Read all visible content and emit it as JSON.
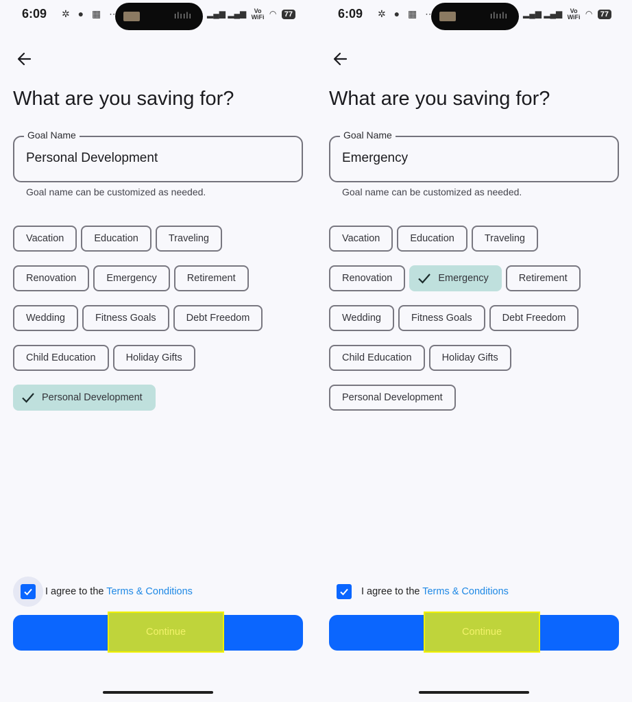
{
  "screens": [
    {
      "id": "left",
      "status": {
        "time": "6:09",
        "battery": "77",
        "wifi_label_top": "Vo",
        "wifi_label_bottom": "WiFi"
      },
      "title": "What are you saving for?",
      "goal_field": {
        "label": "Goal Name",
        "value": "Personal Development"
      },
      "helper": "Goal name can be customized as needed.",
      "chip_rows": [
        [
          {
            "label": "Vacation",
            "selected": false
          },
          {
            "label": "Education",
            "selected": false
          },
          {
            "label": "Traveling",
            "selected": false
          }
        ],
        [
          {
            "label": "Renovation",
            "selected": false
          },
          {
            "label": "Emergency",
            "selected": false
          },
          {
            "label": "Retirement",
            "selected": false
          }
        ],
        [
          {
            "label": "Wedding",
            "selected": false
          },
          {
            "label": "Fitness Goals",
            "selected": false
          },
          {
            "label": "Debt Freedom",
            "selected": false
          }
        ],
        [
          {
            "label": "Child Education",
            "selected": false
          },
          {
            "label": "Holiday Gifts",
            "selected": false
          }
        ],
        [
          {
            "label": "Personal Development",
            "selected": true
          }
        ]
      ],
      "agree": {
        "prefix": "I agree to the ",
        "link": "Terms & Conditions",
        "checked": true
      },
      "continue_label": "Continue"
    },
    {
      "id": "right",
      "status": {
        "time": "6:09",
        "battery": "77",
        "wifi_label_top": "Vo",
        "wifi_label_bottom": "WiFi"
      },
      "title": "What are you saving for?",
      "goal_field": {
        "label": "Goal Name",
        "value": "Emergency"
      },
      "helper": "Goal name can be customized as needed.",
      "chip_rows": [
        [
          {
            "label": "Vacation",
            "selected": false
          },
          {
            "label": "Education",
            "selected": false
          },
          {
            "label": "Traveling",
            "selected": false
          }
        ],
        [
          {
            "label": "Renovation",
            "selected": false
          },
          {
            "label": "Emergency",
            "selected": true
          },
          {
            "label": "Retirement",
            "selected": false
          }
        ],
        [
          {
            "label": "Wedding",
            "selected": false
          },
          {
            "label": "Fitness Goals",
            "selected": false
          },
          {
            "label": "Debt Freedom",
            "selected": false
          }
        ],
        [
          {
            "label": "Child Education",
            "selected": false
          },
          {
            "label": "Holiday Gifts",
            "selected": false
          }
        ],
        [
          {
            "label": "Personal Development",
            "selected": false
          }
        ]
      ],
      "agree": {
        "prefix": "I agree to the ",
        "link": "Terms & Conditions",
        "checked": true
      },
      "continue_label": "Continue"
    }
  ],
  "colors": {
    "primary": "#0b66fe",
    "chip_selected": "#bfe0dd",
    "link": "#1e88e5",
    "highlight": "#bfd43b"
  },
  "icons": [
    "back-arrow-icon",
    "check-icon",
    "checkbox-check-icon"
  ]
}
